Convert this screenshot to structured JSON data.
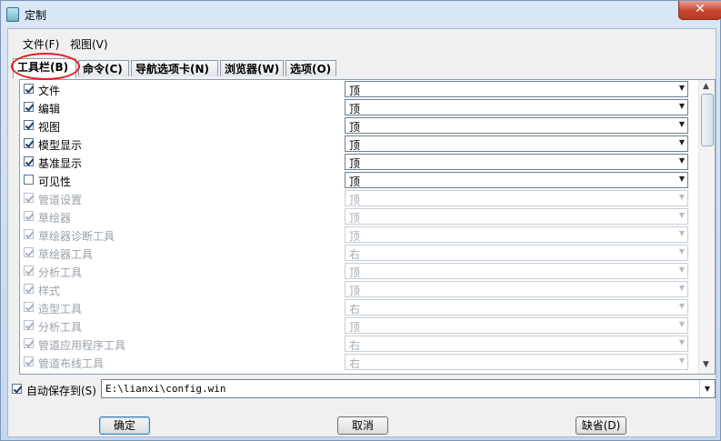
{
  "window": {
    "title": "定制",
    "close_glyph": "✕"
  },
  "menu": [
    "文件(F)",
    "视图(V)"
  ],
  "tabs": [
    {
      "label": "工具栏(B)",
      "active": true
    },
    {
      "label": "命令(C)",
      "active": false
    },
    {
      "label": "导航选项卡(N)",
      "active": false
    },
    {
      "label": "浏览器(W)",
      "active": false
    },
    {
      "label": "选项(O)",
      "active": false
    }
  ],
  "toolbars": [
    {
      "label": "文件",
      "checked": true,
      "enabled": true,
      "position": "顶"
    },
    {
      "label": "编辑",
      "checked": true,
      "enabled": true,
      "position": "顶"
    },
    {
      "label": "视图",
      "checked": true,
      "enabled": true,
      "position": "顶"
    },
    {
      "label": "模型显示",
      "checked": true,
      "enabled": true,
      "position": "顶"
    },
    {
      "label": "基准显示",
      "checked": true,
      "enabled": true,
      "position": "顶"
    },
    {
      "label": "可见性",
      "checked": false,
      "enabled": true,
      "position": "顶"
    },
    {
      "label": "管道设置",
      "checked": true,
      "enabled": false,
      "position": "顶"
    },
    {
      "label": "草绘器",
      "checked": true,
      "enabled": false,
      "position": "顶"
    },
    {
      "label": "草绘器诊断工具",
      "checked": true,
      "enabled": false,
      "position": "顶"
    },
    {
      "label": "草绘器工具",
      "checked": true,
      "enabled": false,
      "position": "右"
    },
    {
      "label": "分析工具",
      "checked": true,
      "enabled": false,
      "position": "顶"
    },
    {
      "label": "样式",
      "checked": true,
      "enabled": false,
      "position": "顶"
    },
    {
      "label": "造型工具",
      "checked": true,
      "enabled": false,
      "position": "右"
    },
    {
      "label": "分析工具",
      "checked": true,
      "enabled": false,
      "position": "顶"
    },
    {
      "label": "管道应用程序工具",
      "checked": true,
      "enabled": false,
      "position": "右"
    },
    {
      "label": "管道布线工具",
      "checked": true,
      "enabled": false,
      "position": "右"
    }
  ],
  "autosave": {
    "checked": true,
    "label": "自动保存到(S)",
    "path": "E:\\lianxi\\config.win"
  },
  "buttons": {
    "ok": "确定",
    "cancel": "取消",
    "default": "缺省(D)"
  },
  "colors": {
    "highlight_circle": "#e21e1e",
    "title_bg": "#cfe0f2"
  }
}
